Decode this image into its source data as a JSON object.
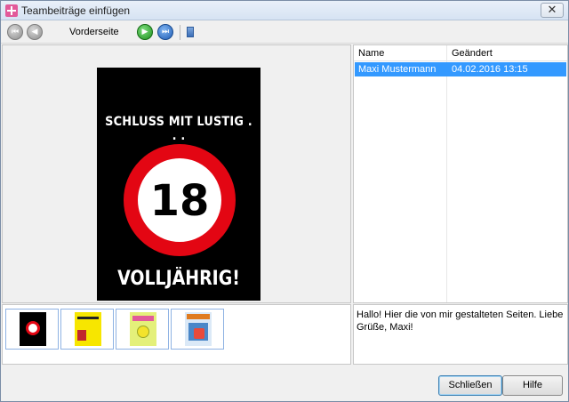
{
  "window": {
    "title": "Teambeiträge einfügen",
    "close_glyph": "✕"
  },
  "toolbar": {
    "first_glyph": "⏮",
    "prev_glyph": "◀",
    "page_label": "Vorderseite",
    "next_glyph": "▶",
    "last_glyph": "⏭",
    "icons": [
      "first-page-icon",
      "previous-page-icon",
      "next-page-icon",
      "last-page-icon",
      "page-icon"
    ]
  },
  "card": {
    "top_text": "SCHLUSS MIT LUSTIG . . .",
    "number": "18",
    "bottom_text": "VOLLJÄHRIG!",
    "colors": {
      "background": "#000000",
      "ring": "#e30613",
      "text": "#ffffff"
    }
  },
  "list": {
    "columns": [
      "Name",
      "Geändert"
    ],
    "rows": [
      {
        "name": "Maxi Mustermann",
        "changed": "04.02.2016 13:15",
        "selected": true
      }
    ],
    "selection_color": "#3399ff"
  },
  "thumbnails": [
    {
      "kind": "volljaehrig-card"
    },
    {
      "kind": "yellow-card"
    },
    {
      "kind": "lime-card"
    },
    {
      "kind": "newspaper-card"
    }
  ],
  "comment": "Hallo! Hier die von mir gestalteten Seiten. Liebe Grüße, Maxi!",
  "buttons": {
    "close_label": "Schließen",
    "help_label": "Hilfe"
  }
}
